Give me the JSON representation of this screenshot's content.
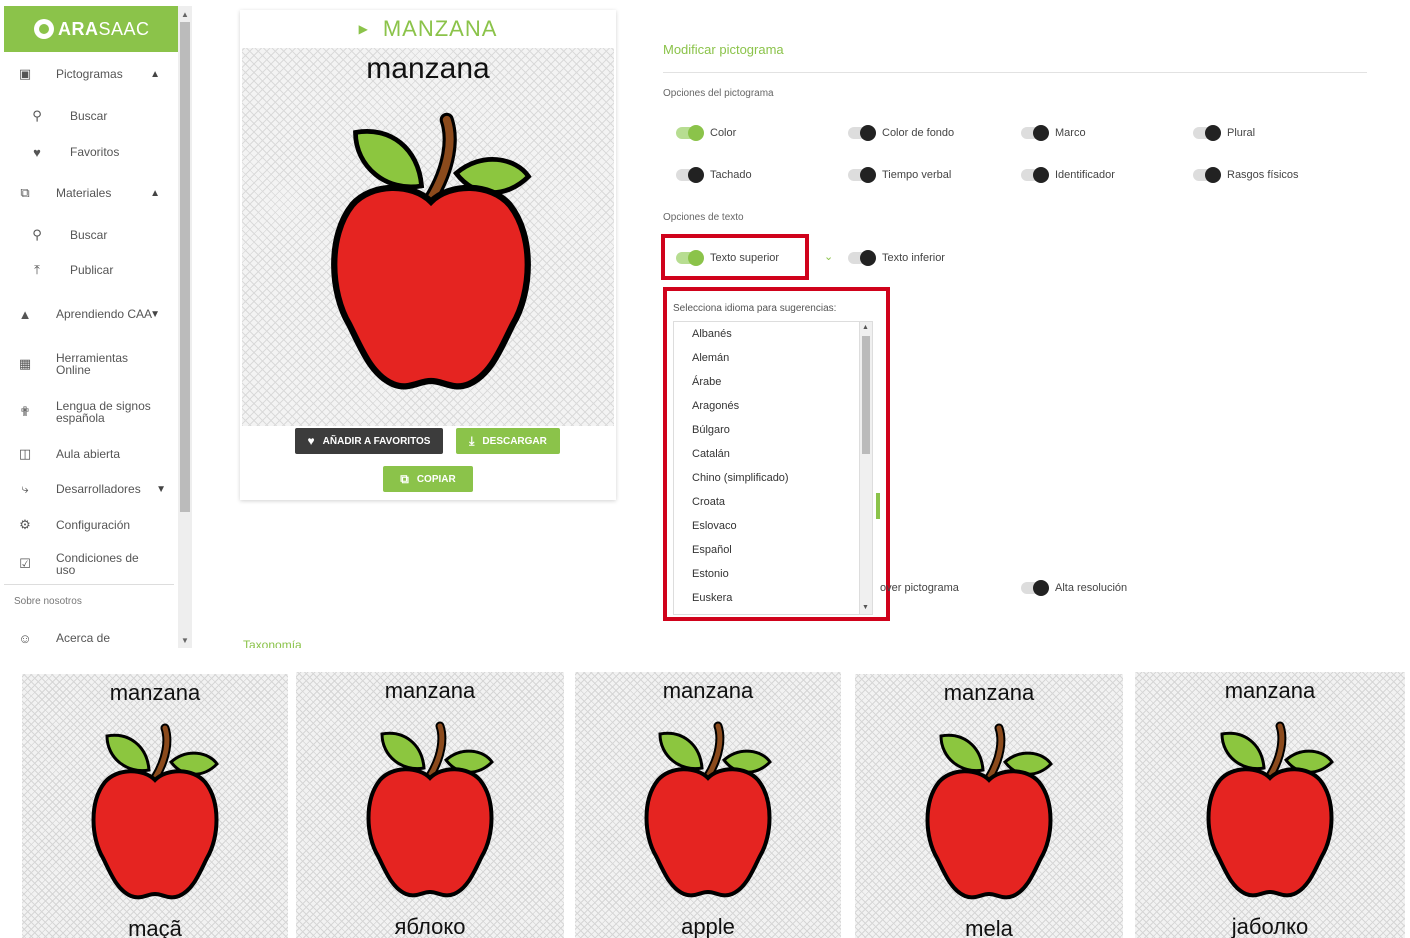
{
  "brand": {
    "name_bold": "ARA",
    "name_rest": "SAAC"
  },
  "sidebar": {
    "items": [
      {
        "label": "Pictogramas",
        "icon": "image-icon",
        "chevron": "up"
      },
      {
        "label": "Buscar",
        "icon": "search-icon"
      },
      {
        "label": "Favoritos",
        "icon": "heart-icon"
      },
      {
        "label": "Materiales",
        "icon": "collection-icon",
        "chevron": "up"
      },
      {
        "label": "Buscar",
        "icon": "search-icon"
      },
      {
        "label": "Publicar",
        "icon": "upload-icon"
      },
      {
        "label": "Aprendiendo CAA",
        "icon": "school-icon",
        "chevron": "down"
      },
      {
        "label": "Herramientas Online",
        "icon": "apps-grid-icon"
      },
      {
        "label": "Lengua de signos española",
        "icon": "person-sign-icon"
      },
      {
        "label": "Aula abierta",
        "icon": "classroom-icon"
      },
      {
        "label": "Desarrolladores",
        "icon": "wrench-icon",
        "chevron": "down"
      },
      {
        "label": "Configuración",
        "icon": "gear-icon"
      },
      {
        "label": "Condiciones de uso",
        "icon": "clipboard-check-icon"
      }
    ],
    "about_section": "Sobre nosotros",
    "about_item": {
      "label": "Acerca de",
      "icon": "people-icon"
    }
  },
  "card": {
    "title": "MANZANA",
    "word": "manzana",
    "fav_button": "AÑADIR A FAVORITOS",
    "download_button": "DESCARGAR",
    "copy_button": "COPIAR"
  },
  "modify": {
    "title": "Modificar pictograma",
    "pictogram_options_label": "Opciones del pictograma",
    "pictogram_options": [
      {
        "label": "Color",
        "on": true
      },
      {
        "label": "Color de fondo",
        "on": false
      },
      {
        "label": "Marco",
        "on": false
      },
      {
        "label": "Plural",
        "on": false
      },
      {
        "label": "Tachado",
        "on": false
      },
      {
        "label": "Tiempo verbal",
        "on": false
      },
      {
        "label": "Identificador",
        "on": false
      },
      {
        "label": "Rasgos físicos",
        "on": false
      }
    ],
    "text_options_label": "Opciones de texto",
    "text_options": [
      {
        "label": "Texto superior",
        "on": true
      },
      {
        "label": "Texto inferior",
        "on": false
      }
    ],
    "language_prompt": "Selecciona idioma para sugerencias:",
    "languages": [
      "Albanés",
      "Alemán",
      "Árabe",
      "Aragonés",
      "Búlgaro",
      "Catalán",
      "Chino (simplificado)",
      "Croata",
      "Eslovaco",
      "Español",
      "Estonio",
      "Euskera"
    ],
    "extra_options": [
      {
        "label": "over pictograma"
      },
      {
        "label": "Alta resolución",
        "on": false
      }
    ],
    "taxonomy_label": "Taxonomía"
  },
  "examples": [
    {
      "top": "manzana",
      "bottom": "maçã"
    },
    {
      "top": "manzana",
      "bottom": "яблоко"
    },
    {
      "top": "manzana",
      "bottom": "apple"
    },
    {
      "top": "manzana",
      "bottom": "mela"
    },
    {
      "top": "manzana",
      "bottom": "јаболко"
    }
  ],
  "colors": {
    "accent": "#8bc34a",
    "highlight": "#d0021b",
    "apple": "#e52421",
    "leaf": "#8cc63f",
    "stem": "#8b4a1c"
  }
}
